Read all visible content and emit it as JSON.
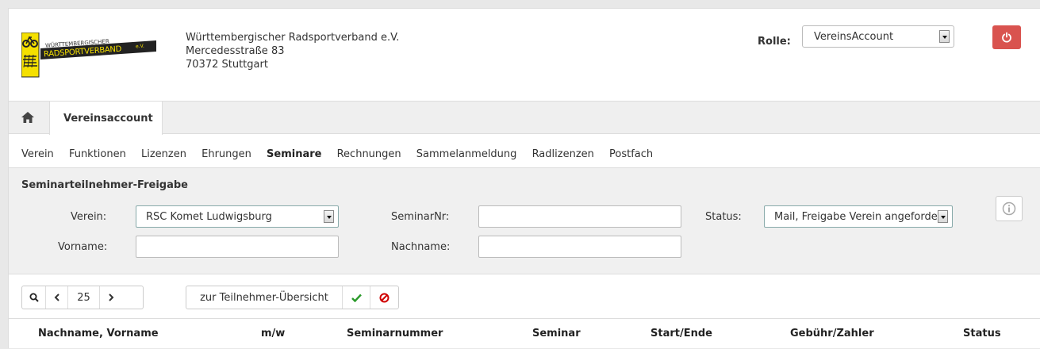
{
  "logo": {
    "line1": "WÜRTTEMBERGISCHER",
    "line2": "RADSPORTVERBAND",
    "suffix": "e.V."
  },
  "address": {
    "name": "Württembergischer Radsportverband e.V.",
    "street": "Mercedesstraße 83",
    "city": "70372 Stuttgart"
  },
  "role": {
    "label": "Rolle:",
    "value": "VereinsAccount"
  },
  "icons": {
    "power": "power-icon",
    "home": "home-icon",
    "info": "info-icon",
    "search": "search-icon",
    "prev": "chevron-left-icon",
    "next": "chevron-right-icon",
    "check": "check-icon",
    "deny": "ban-icon"
  },
  "tabs": {
    "active": "Vereinsaccount"
  },
  "subnav": [
    "Verein",
    "Funktionen",
    "Lizenzen",
    "Ehrungen",
    "Seminare",
    "Rechnungen",
    "Sammelanmeldung",
    "Radlizenzen",
    "Postfach"
  ],
  "subnav_active": "Seminare",
  "filter": {
    "title": "Seminarteilnehmer-Freigabe",
    "verein_label": "Verein:",
    "verein_value": "RSC Komet Ludwigsburg",
    "seminarnr_label": "SeminarNr:",
    "seminarnr_value": "",
    "status_label": "Status:",
    "status_value": "Mail, Freigabe Verein angeforde",
    "vorname_label": "Vorname:",
    "vorname_value": "",
    "nachname_label": "Nachname:",
    "nachname_value": ""
  },
  "toolbar": {
    "page_size": "25",
    "overview_label": "zur Teilnehmer-Übersicht"
  },
  "columns": [
    "Nachname, Vorname",
    "m/w",
    "Seminarnummer",
    "Seminar",
    "Start/Ende",
    "Gebühr/Zahler",
    "Status"
  ],
  "colors": {
    "accent_red": "#d9534f",
    "check_green": "#2a9a2a",
    "ban_red": "#d00000",
    "logo_yellow": "#f5e000"
  }
}
